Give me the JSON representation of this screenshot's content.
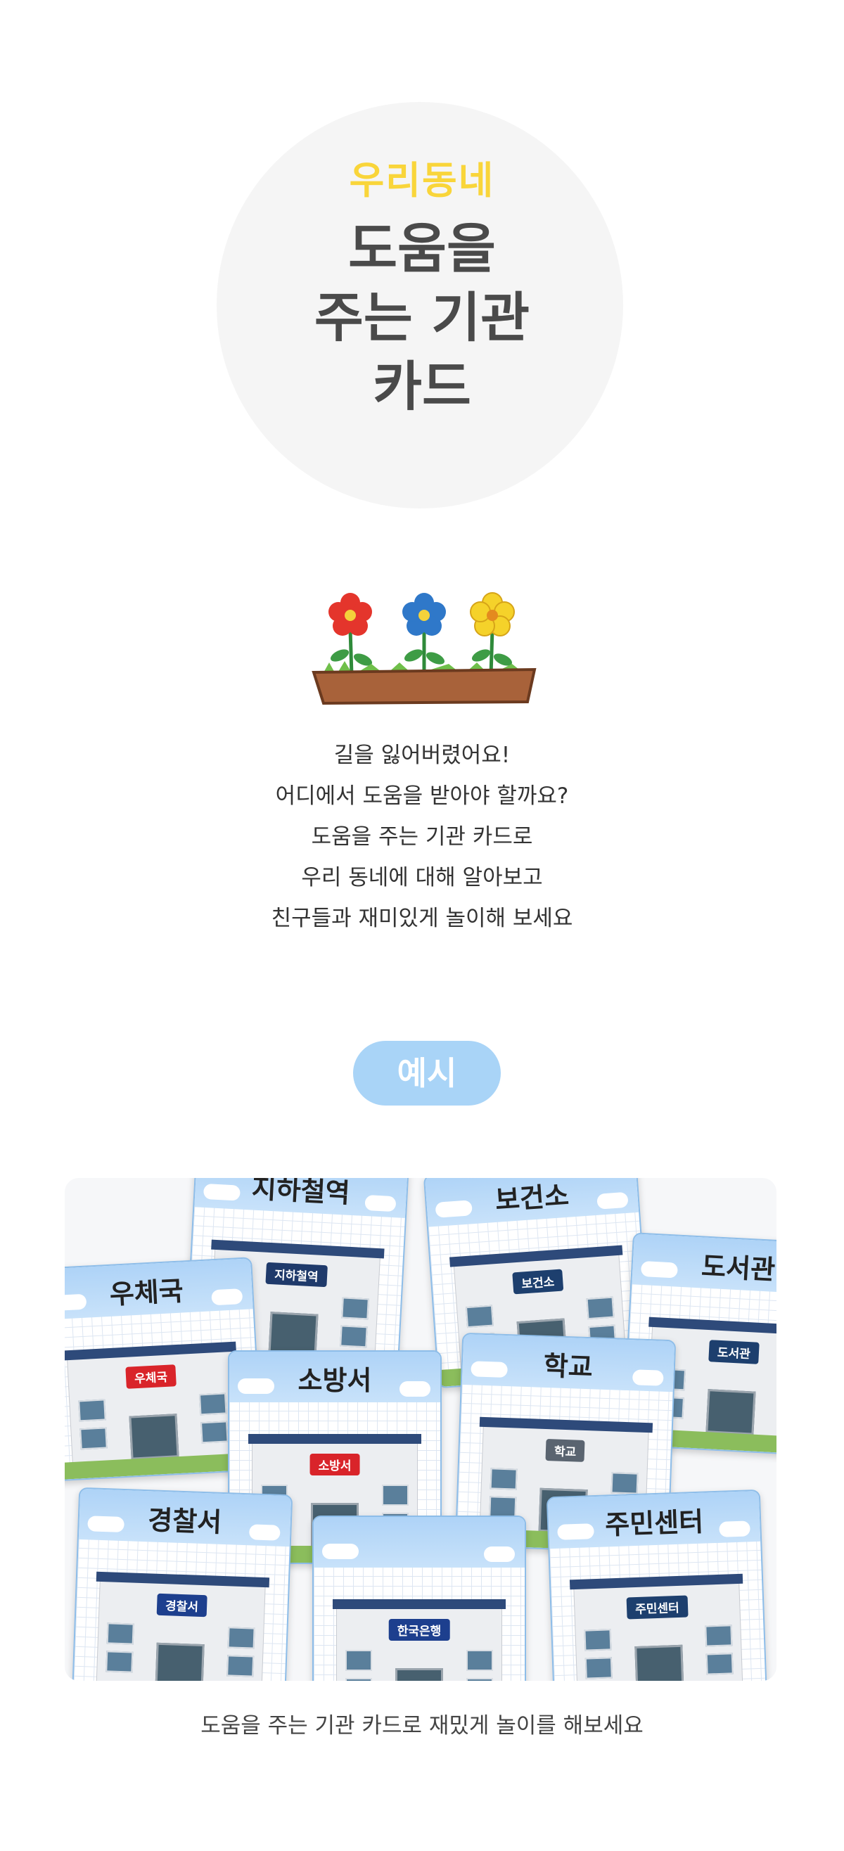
{
  "hero": {
    "subtitle": "우리동네",
    "title_lines": [
      "도움을",
      "주는 기관",
      "카드"
    ]
  },
  "intro": {
    "lines": [
      "길을 잃어버렸어요!",
      "어디에서 도움을 받아야 할까요?",
      "도움을 주는 기관 카드로",
      "우리 동네에 대해 알아보고",
      "친구들과 재미있게 놀이해 보세요"
    ]
  },
  "example": {
    "label": "예시"
  },
  "cards": [
    {
      "name": "지하철역",
      "sign": "지하철역",
      "sign_color": "#1f3a6b",
      "icon": "subway-icon"
    },
    {
      "name": "보건소",
      "sign": "보건소",
      "sign_color": "#1d3f6e",
      "icon": "health-center-icon"
    },
    {
      "name": "도서관",
      "sign": "도서관",
      "sign_color": "#1d3f6e",
      "icon": "library-icon"
    },
    {
      "name": "우체국",
      "sign": "우체국",
      "sign_color": "#d9242a",
      "icon": "post-office-icon"
    },
    {
      "name": "소방서",
      "sign": "소방서",
      "sign_color": "#d9242a",
      "icon": "fire-station-icon"
    },
    {
      "name": "학교",
      "sign": "학교",
      "sign_color": "#5a6470",
      "icon": "school-icon"
    },
    {
      "name": "경찰서",
      "sign": "경찰서",
      "sign_color": "#1d3f8e",
      "icon": "police-station-icon"
    },
    {
      "name": "",
      "sign": "한국은행",
      "sign_color": "#1d3f8e",
      "icon": "bank-icon"
    },
    {
      "name": "주민센터",
      "sign": "주민센터",
      "sign_color": "#1d3f6e",
      "icon": "community-center-icon"
    }
  ],
  "caption": "도움을 주는 기관 카드로 재밌게 놀이를 해보세요",
  "colors": {
    "accent_yellow": "#f9d53a",
    "title_gray": "#4a4a4a",
    "pill_blue": "#a9d4f7",
    "card_border": "#8dbde9"
  }
}
